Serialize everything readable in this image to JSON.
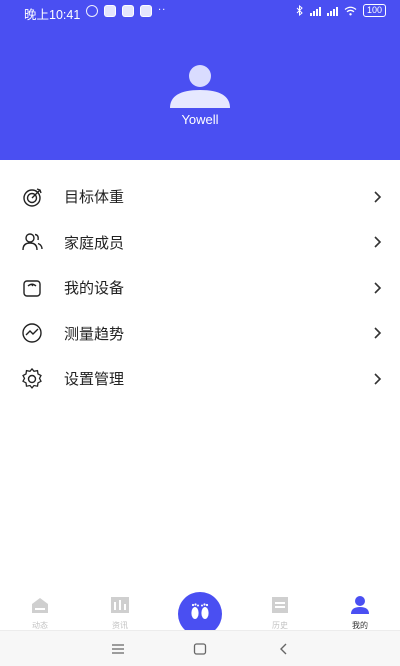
{
  "status_bar": {
    "time": "晚上10:41",
    "dots": "··",
    "battery": "100",
    "bluetooth_icon": "bluetooth-icon",
    "wifi_icon": "wifi-icon"
  },
  "profile": {
    "username": "Yowell",
    "avatar_icon": "person-avatar-icon"
  },
  "colors": {
    "accent": "#4a4ff2",
    "text": "#222222",
    "muted": "#c2c2c2"
  },
  "menu": {
    "items": [
      {
        "label": "目标体重",
        "icon": "target-icon"
      },
      {
        "label": "家庭成员",
        "icon": "people-icon"
      },
      {
        "label": "我的设备",
        "icon": "scale-icon"
      },
      {
        "label": "测量趋势",
        "icon": "trend-icon"
      },
      {
        "label": "设置管理",
        "icon": "gear-icon"
      }
    ]
  },
  "tabbar": {
    "tabs": [
      {
        "label": "动态",
        "icon": "home-icon"
      },
      {
        "label": "资讯",
        "icon": "news-icon"
      },
      {
        "label": "",
        "icon": "footprints-icon"
      },
      {
        "label": "历史",
        "icon": "history-icon"
      },
      {
        "label": "我的",
        "icon": "profile-icon",
        "active": true
      }
    ]
  }
}
